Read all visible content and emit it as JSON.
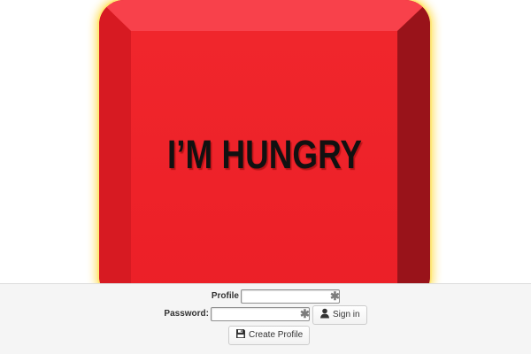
{
  "hero": {
    "button_label": "I’M HUNGRY",
    "face_color": "#ec1f27",
    "glow_color": "#ffe97a"
  },
  "login": {
    "profile_name_label": "Profile Name:",
    "profile_name_value": "",
    "password_label": "Password:",
    "password_value": "",
    "required_marker": "✱",
    "sign_in_label": "Sign in",
    "create_profile_label": "Create Profile",
    "user_icon": "user-icon",
    "save_icon": "floppy-disk-icon"
  }
}
